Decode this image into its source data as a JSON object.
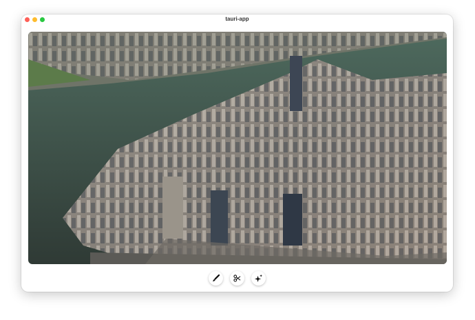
{
  "window": {
    "title": "tauri-app"
  },
  "colors": {
    "close": "#fe5f57",
    "minimize": "#febc2e",
    "maximize": "#28c840",
    "water": "#3b4a44"
  },
  "toolbar": {
    "buttons": [
      {
        "icon": "paintbrush-icon"
      },
      {
        "icon": "scissors-icon"
      },
      {
        "icon": "sparkles-icon"
      }
    ]
  }
}
